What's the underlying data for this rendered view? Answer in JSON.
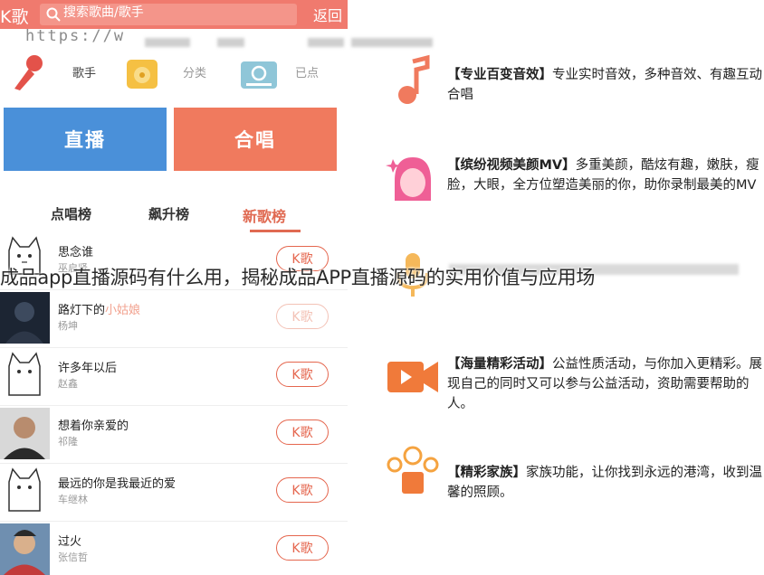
{
  "topbar": {
    "mode_label": "K歌",
    "search_placeholder": "搜索歌曲/歌手",
    "back_label": "返回"
  },
  "url_watermark": "https://w",
  "categories": [
    {
      "label": "歌手",
      "icon": "microphone-icon"
    },
    {
      "label": "分类",
      "icon": "vinyl-record-icon"
    },
    {
      "label": "已点",
      "icon": "radio-icon"
    }
  ],
  "big_buttons": {
    "live": "直播",
    "chorus": "合唱"
  },
  "tabs": [
    "点唱榜",
    "飙升榜",
    "新歌榜"
  ],
  "songs": [
    {
      "title": "思念谁",
      "singer": "巫启贤",
      "k_label": "K歌"
    },
    {
      "title": "路灯下的",
      "title_highlight": "小姑娘",
      "singer": "杨坤",
      "k_label": "K歌"
    },
    {
      "title": "许多年以后",
      "singer": "赵鑫",
      "k_label": "K歌"
    },
    {
      "title": "想着你亲爱的",
      "singer": "祁隆",
      "k_label": "K歌"
    },
    {
      "title": "最远的你是我最近的爱",
      "singer": "车继林",
      "k_label": "K歌"
    },
    {
      "title": "过火",
      "singer": "张信哲",
      "k_label": "K歌"
    }
  ],
  "features": [
    {
      "icon": "music-note-icon",
      "title": "【专业百变音效】",
      "text": "专业实时音效，多种音效、有趣互动合唱"
    },
    {
      "icon": "beauty-face-icon",
      "title": "【缤纷视频美颜MV】",
      "text": "多重美颜，酷炫有趣，嫩肤，瘦脸，大眼，全方位塑造美丽的你，助你录制最美的MV"
    },
    {
      "icon": "video-camera-icon",
      "title": "【海量精彩活动】",
      "text": "公益性质活动，与你加入更精彩。展现自己的同时又可以参与公益活动，资助需要帮助的人。"
    },
    {
      "icon": "family-group-icon",
      "title": "【精彩家族】",
      "text": "家族功能，让你找到永远的港湾，收到温馨的照顾。"
    }
  ],
  "overlay_title": "成品app直播源码有什么用，揭秘成品APP直播源码的实用价值与应用场",
  "colors": {
    "accent": "#f07a6e",
    "live": "#4a90d9",
    "chorus": "#f07a5e",
    "k_button": "#e5664e"
  }
}
